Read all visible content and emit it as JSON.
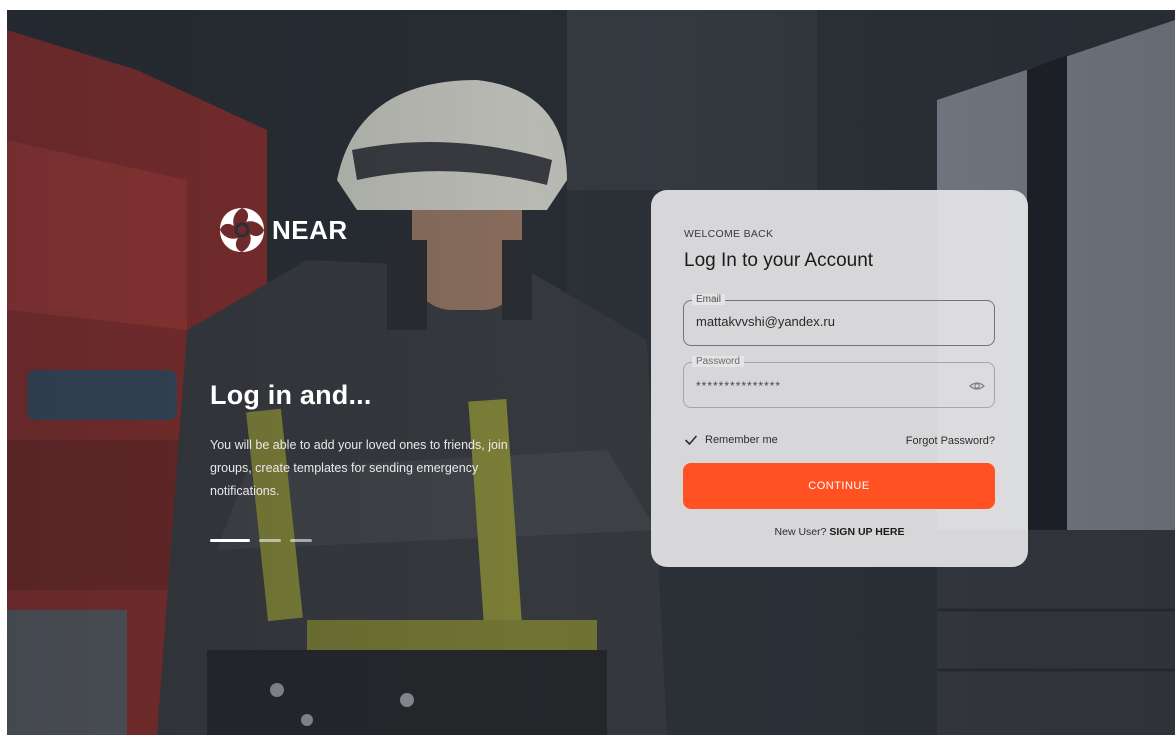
{
  "brand": {
    "name": "NEAR",
    "logo_icon": "near-logo-icon"
  },
  "hero": {
    "title": "Log in and...",
    "description": "You will be able to add your loved ones to friends, join groups, create templates for sending emergency notifications.",
    "carousel": {
      "total": 3,
      "active_index": 0
    }
  },
  "form": {
    "eyebrow": "WELCOME BACK",
    "title": "Log In to your Account",
    "email": {
      "label": "Email",
      "value": "mattakvvshi@yandex.ru"
    },
    "password": {
      "label": "Password",
      "value": "***************",
      "toggle_icon": "eye-icon"
    },
    "remember": {
      "label": "Remember me",
      "checked": true,
      "icon": "checkmark-icon"
    },
    "forgot_label": "Forgot Password?",
    "continue_label": "CONTINUE",
    "signup_prompt": "New User?",
    "signup_link": "SIGN UP HERE"
  },
  "colors": {
    "accent": "#ff5122",
    "card_bg": "#e4e4e6",
    "text_dark": "#1b1b1b"
  }
}
